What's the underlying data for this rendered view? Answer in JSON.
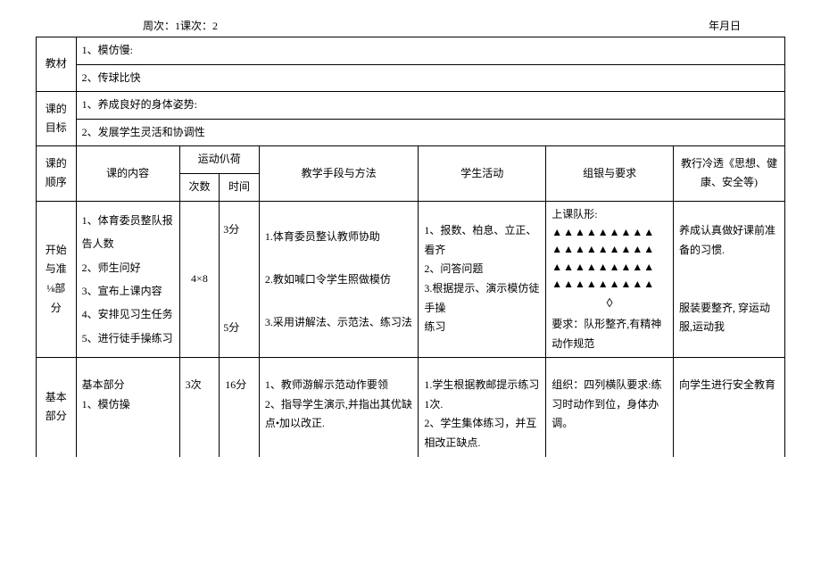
{
  "header": {
    "left": "周次：1课次：2",
    "right": "年月日"
  },
  "rows": {
    "jiaocai_label": "教材",
    "jiaocai_1": "1、模仿慢:",
    "jiaocai_2": "2、传球比快",
    "mubiao_label": "课的目标",
    "mubiao_1": "1、养成良好的身体姿势:",
    "mubiao_2": "2、发展学生灵活和协调性",
    "th_seq": "课的顺序",
    "th_content": "课的内容",
    "th_load": "运动仈荷",
    "th_count": "次数",
    "th_time": "时间",
    "th_method": "教学手段与方法",
    "th_activity": "学生活动",
    "th_org": "组银与要求",
    "th_edu": "教行冷透《思想、健康、安全等)"
  },
  "section1": {
    "seq": "开始与准⅛部分",
    "content": "1、体育委员整队报告人数\n2、师生问好\n3、宣布上课内容\n4、安排见习生任务\n5、进行徒手操练习",
    "count": "4×8",
    "time_top": "3分",
    "time_bottom": "5分",
    "method": "1.体育委员整认教师协助\n\n2.教如喊口令学生照做模仿\n\n3.采用讲解法、示范法、练习法",
    "activity": "1、报数、柏息、立正、看齐\n2、问答问题\n3.根据提示、演示模仿徒手操\n练习",
    "org_label": "上课队形:",
    "org_tri": "▲▲▲▲▲▲▲▲▲\n▲▲▲▲▲▲▲▲▲\n▲▲▲▲▲▲▲▲▲\n▲▲▲▲▲▲▲▲▲",
    "org_diamond": "◊",
    "org_req": "要求：队形整齐,有精神动作规范",
    "edu": "养成认真做好课前准备的习惯.\n\n\n服装要整齐, 穿运动服,运动我"
  },
  "section2": {
    "seq": "基本部分",
    "content_title": "基本部分",
    "content_1": "1、模仿操",
    "count": "3次",
    "time": "16分",
    "method": "1、教师游解示范动作要领\n2、指导学生演示,并指出其优缺点•加以改正.",
    "activity": "1.学生根据教邮提示练习1次.\n2、学生集体练习，并互相改正缺点.",
    "org": "组织：四列横队要求:练习时动作到位，身体办调。",
    "edu": "向学生进行安全教育"
  }
}
